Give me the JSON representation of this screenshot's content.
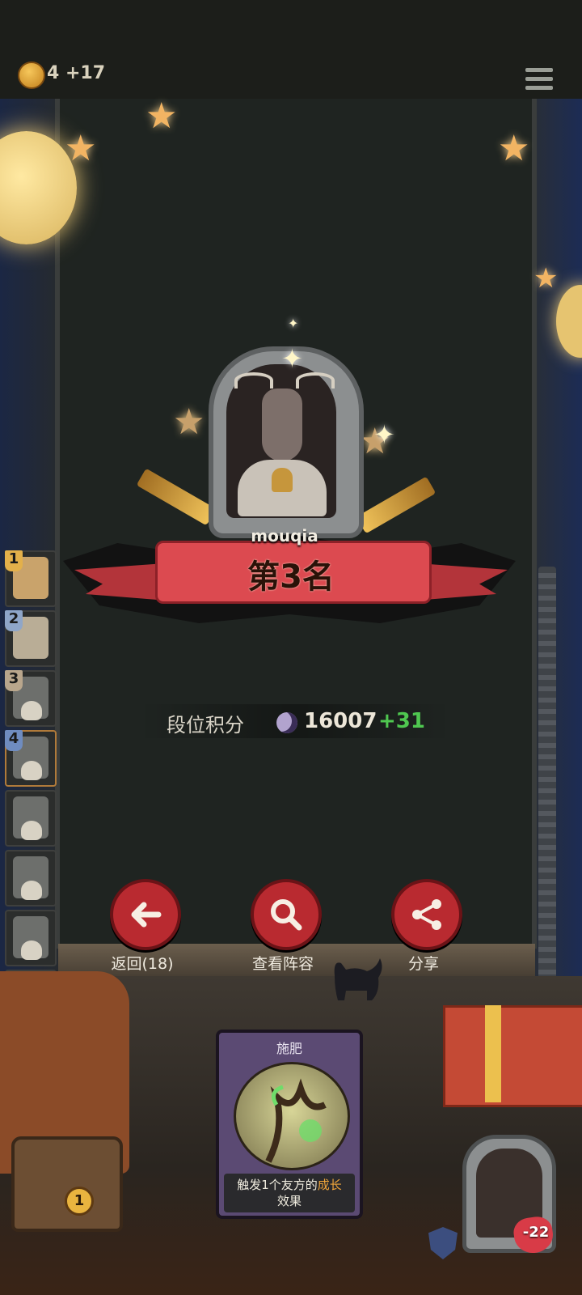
{
  "top_bar": {
    "coin_icon": "crown-coin-icon",
    "coins": "4",
    "coins_gain": "+17",
    "menu_icon": "hamburger-menu-icon"
  },
  "result": {
    "player_name": "mouqia",
    "rank_label": "第3名",
    "score_label": "段位积分",
    "score_icon": "moon-icon",
    "score_value": "16007",
    "score_delta": "+31"
  },
  "sidebar": {
    "slots": [
      {
        "number": "1",
        "eliminated": false,
        "badge_color": "#e3b04a"
      },
      {
        "number": "2",
        "eliminated": false,
        "badge_color": "#8fa6c8"
      },
      {
        "number": "3",
        "eliminated": true,
        "badge_color": "#b9a68c"
      },
      {
        "number": "4",
        "eliminated": true,
        "badge_color": "#6f8cc0",
        "highlighted": true
      },
      {
        "number": "",
        "eliminated": true
      },
      {
        "number": "",
        "eliminated": true
      },
      {
        "number": "",
        "eliminated": true
      },
      {
        "number": "",
        "eliminated": true
      }
    ]
  },
  "actions": {
    "back_label": "返回(18)",
    "back_icon": "arrow-left-icon",
    "view_lineup_label": "查看阵容",
    "view_lineup_icon": "search-icon",
    "share_label": "分享",
    "share_icon": "share-icon"
  },
  "card": {
    "title": "施肥",
    "desc_prefix": "触发1个友方的",
    "desc_highlight": "成长",
    "desc_suffix": "效果"
  },
  "bottom": {
    "chest_level": "1",
    "health": "-22",
    "shield_icon": "shield-icon"
  },
  "colors": {
    "accent_red": "#b92a30",
    "ribbon_red": "#dc4a50",
    "delta_green": "#4fc750",
    "highlight_orange": "#f0a53a"
  }
}
